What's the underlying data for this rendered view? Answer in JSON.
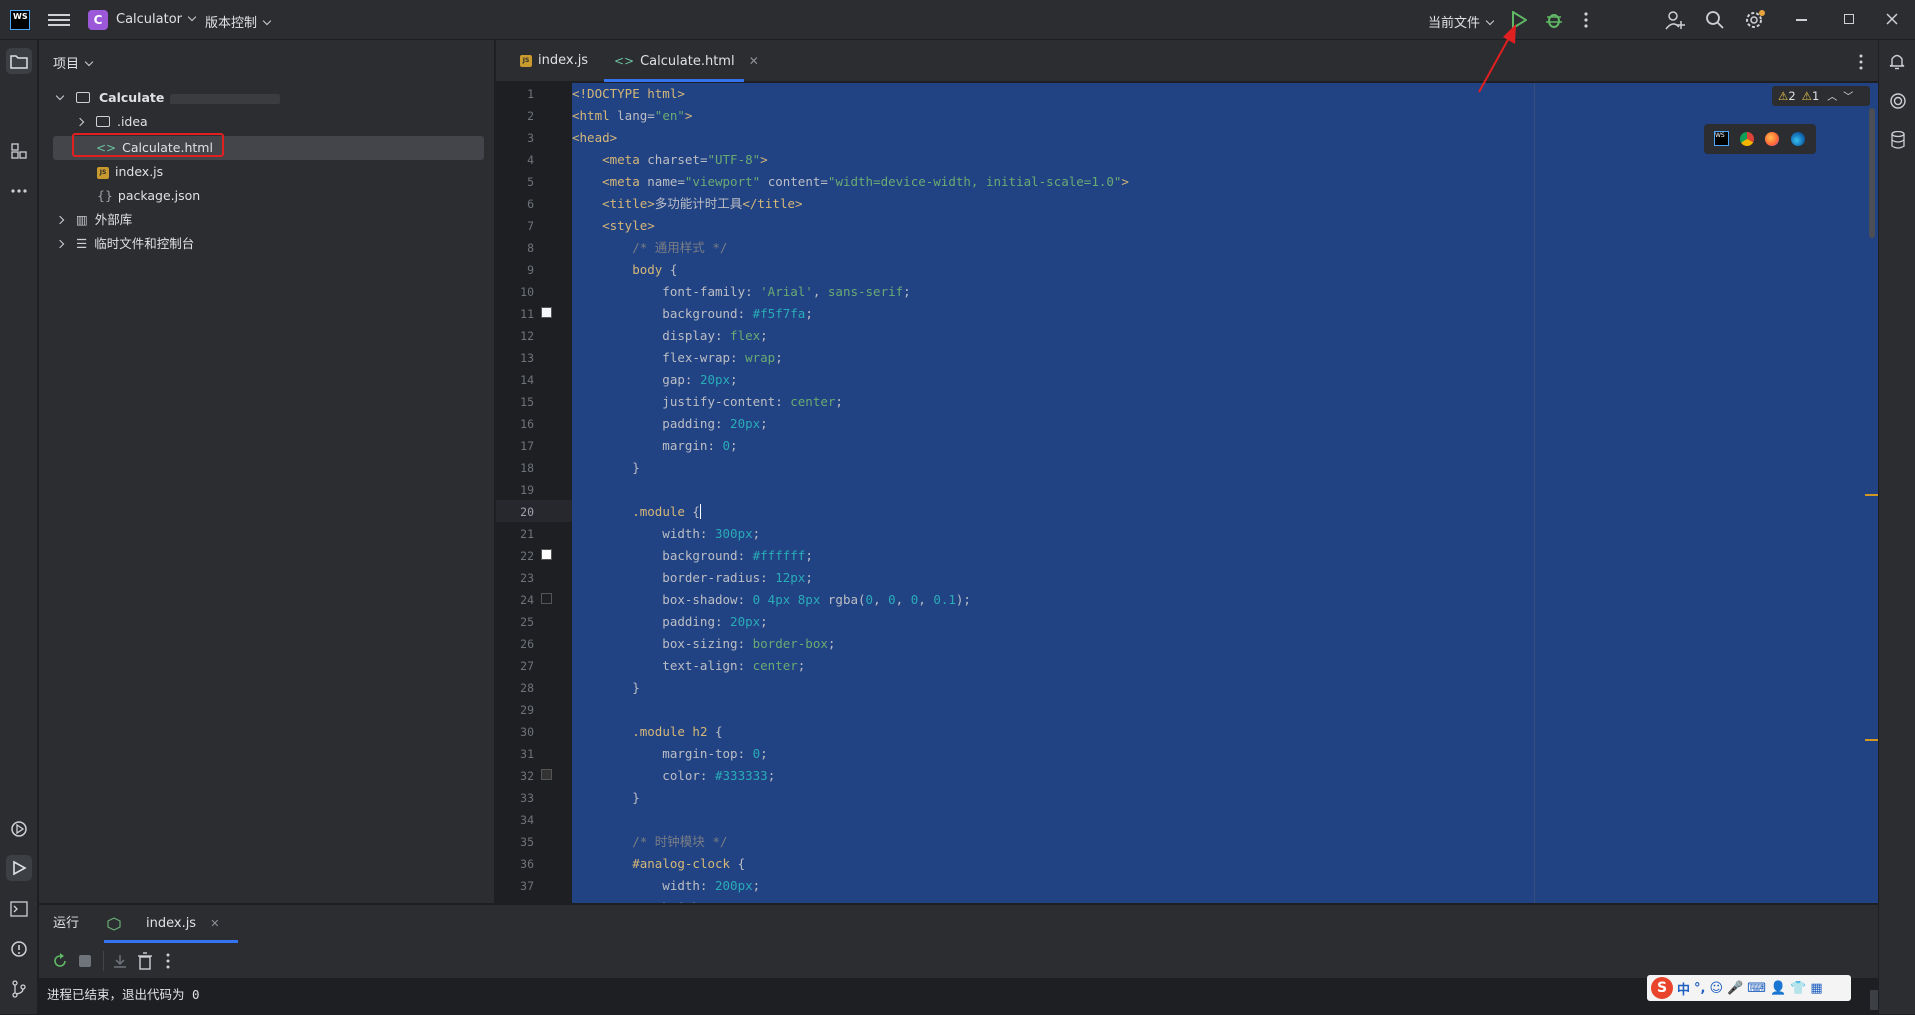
{
  "titlebar": {
    "logo": "WS",
    "project_badge": "C",
    "project_name": "Calculator",
    "vcs_label": "版本控制",
    "run_config": "当前文件"
  },
  "project_panel": {
    "title": "项目",
    "tree": [
      {
        "label": "Calculate",
        "kind": "folder",
        "expanded": true,
        "depth": 0
      },
      {
        "label": ".idea",
        "kind": "folder",
        "expanded": false,
        "depth": 1
      },
      {
        "label": "Calculate.html",
        "kind": "html",
        "depth": 1,
        "selected": true
      },
      {
        "label": "index.js",
        "kind": "js",
        "depth": 1
      },
      {
        "label": "package.json",
        "kind": "json",
        "depth": 1
      },
      {
        "label": "外部库",
        "kind": "library",
        "expanded": false,
        "depth": 0
      },
      {
        "label": "临时文件和控制台",
        "kind": "scratch",
        "expanded": false,
        "depth": 0
      }
    ]
  },
  "editor": {
    "tabs": [
      {
        "label": "index.js",
        "icon": "js-file-icon",
        "active": false
      },
      {
        "label": "Calculate.html",
        "icon": "html-file-icon",
        "active": true
      }
    ],
    "inspections": {
      "warnings": "2",
      "weak_warnings": "1"
    },
    "current_line": 20,
    "line_numbers": [
      "1",
      "2",
      "3",
      "4",
      "5",
      "6",
      "7",
      "8",
      "9",
      "10",
      "11",
      "12",
      "13",
      "14",
      "15",
      "16",
      "17",
      "18",
      "19",
      "20",
      "21",
      "22",
      "23",
      "24",
      "25",
      "26",
      "27",
      "28",
      "29",
      "30",
      "31",
      "32",
      "33",
      "34",
      "35",
      "36",
      "37"
    ]
  },
  "bottom_panel": {
    "tab_run": "运行",
    "tab_file": "index.js",
    "console_output": "进程已结束，退出代码为 0"
  },
  "ime_bar": {
    "label": "中"
  },
  "colors": {
    "selection": "#214283",
    "accent": "#3574f0",
    "highlight_box": "#e02020",
    "arrow": "#e02020"
  }
}
